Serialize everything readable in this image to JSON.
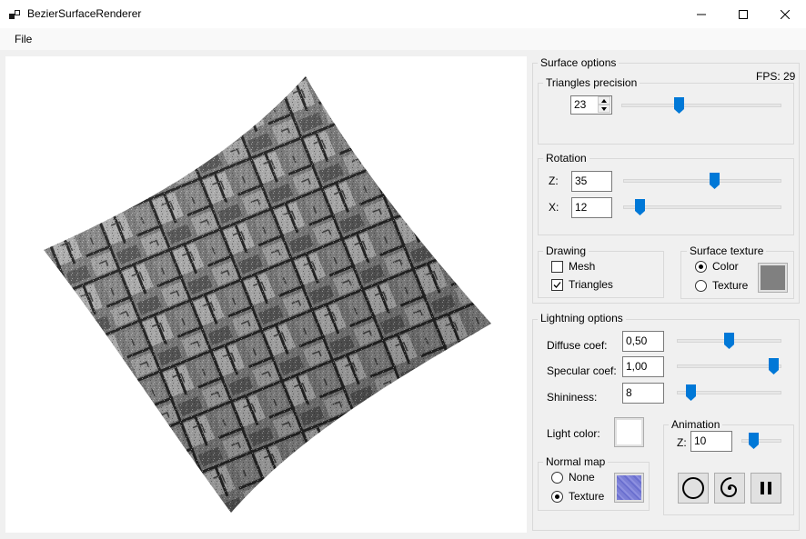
{
  "window": {
    "title": "BezierSurfaceRenderer",
    "controls": [
      "minimize",
      "maximize",
      "close"
    ]
  },
  "menu": {
    "file_label": "File"
  },
  "surface_options": {
    "title": "Surface options",
    "fps_text": "FPS: 29",
    "triangles_precision": {
      "title": "Triangles precision",
      "value": "23",
      "slider_fraction": 0.35
    },
    "rotation": {
      "title": "Rotation",
      "z_label": "Z:",
      "z_value": "35",
      "z_slider_fraction": 0.58,
      "x_label": "X:",
      "x_value": "12",
      "x_slider_fraction": 0.08
    },
    "drawing": {
      "title": "Drawing",
      "mesh_label": "Mesh",
      "mesh_checked": false,
      "triangles_label": "Triangles",
      "triangles_checked": true
    },
    "surface_texture": {
      "title": "Surface texture",
      "color_label": "Color",
      "texture_label": "Texture",
      "selected": "Color",
      "color_swatch": "#808080"
    }
  },
  "lightning_options": {
    "title": "Lightning options",
    "diffuse_label": "Diffuse  coef:",
    "diffuse_value": "0,50",
    "diffuse_slider_fraction": 0.5,
    "specular_label": "Specular coef:",
    "specular_value": "1,00",
    "specular_slider_fraction": 0.97,
    "shininess_label": "Shininess:",
    "shininess_value": "8",
    "shininess_slider_fraction": 0.1,
    "light_color_label": "Light color:",
    "light_color": "#ffffff",
    "normal_map": {
      "title": "Normal map",
      "none_label": "None",
      "texture_label": "Texture",
      "selected": "Texture",
      "swatch_color": "#7b7fd6"
    },
    "animation": {
      "title": "Animation",
      "z_label": "Z:",
      "z_value": "10",
      "slider_fraction": 0.25,
      "buttons": [
        "circle-path",
        "spiral-path",
        "pause"
      ]
    }
  },
  "colors": {
    "accent": "#0078d7",
    "surface_dark": "#3a3a3a",
    "surface_light": "#9a9a9a"
  }
}
